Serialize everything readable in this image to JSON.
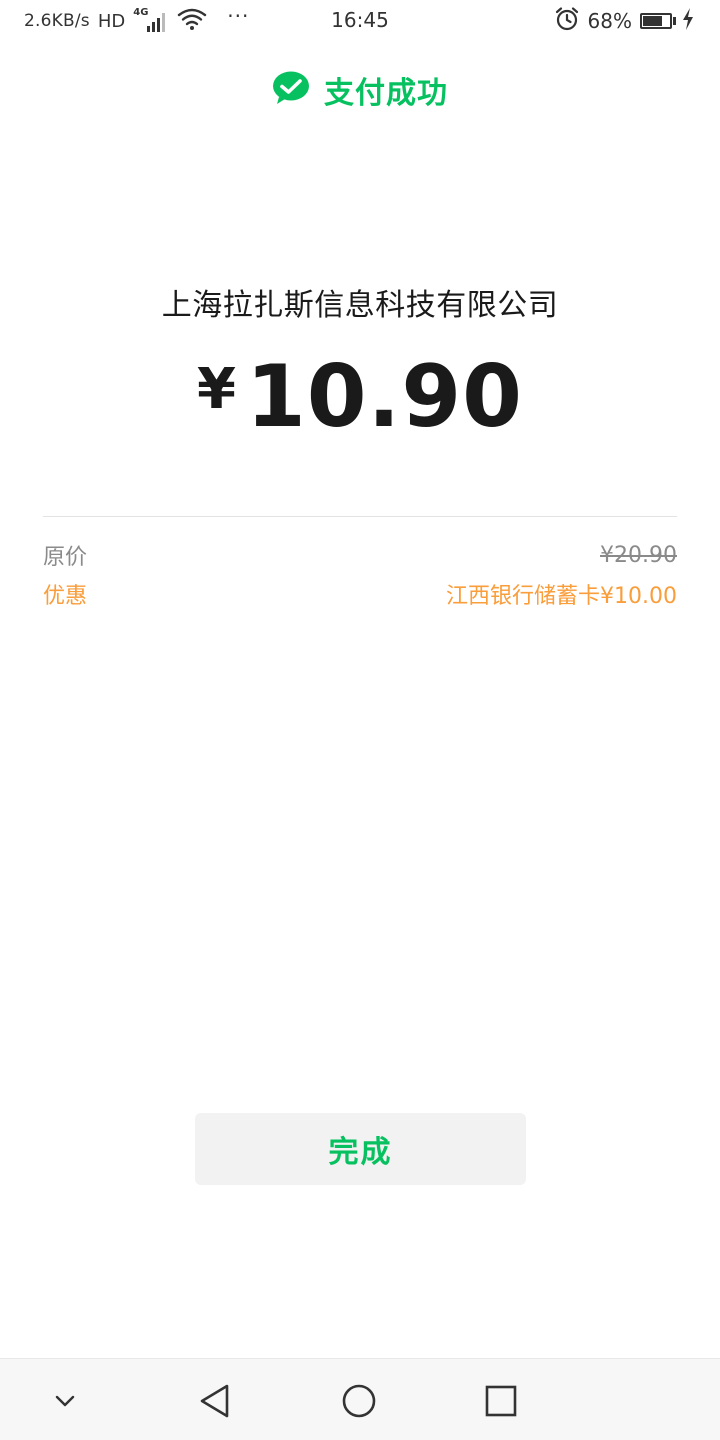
{
  "status_bar": {
    "network_speed": "2.6KB/s",
    "hd": "HD",
    "network_type": "4G",
    "more": "···",
    "time": "16:45",
    "battery_percent": "68%",
    "battery_level": 0.68
  },
  "header": {
    "title": "支付成功",
    "icon": "wechat-pay-check-icon"
  },
  "payment": {
    "merchant": "上海拉扎斯信息科技有限公司",
    "currency_symbol": "¥",
    "amount": "10.90"
  },
  "details": {
    "original_label": "原价",
    "original_value": "¥20.90",
    "discount_label": "优惠",
    "discount_value": "江西银行储蓄卡¥10.00"
  },
  "done_button_label": "完成",
  "nav": {
    "icons": [
      "chevron-down-icon",
      "back-icon",
      "home-icon",
      "recents-icon"
    ]
  },
  "colors": {
    "accent_green": "#07c160",
    "discount_orange": "#fa9d3b",
    "muted_gray": "#8a8a8a",
    "text_dark": "#1a1a1a"
  }
}
